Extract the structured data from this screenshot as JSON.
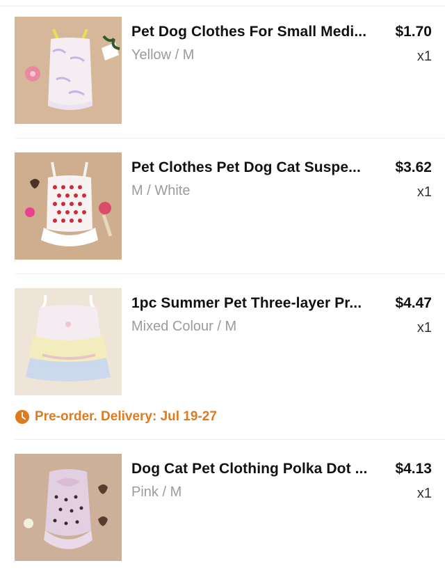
{
  "items": [
    {
      "title": "Pet Dog Clothes For Small Medi...",
      "variant": "Yellow / M",
      "price": "$1.70",
      "qty": "x1"
    },
    {
      "title": "Pet Clothes Pet Dog Cat Suspe...",
      "variant": "M / White",
      "price": "$3.62",
      "qty": "x1"
    },
    {
      "title": "1pc Summer Pet Three-layer Pr...",
      "variant": "Mixed Colour / M",
      "price": "$4.47",
      "qty": "x1"
    },
    {
      "title": "Dog Cat Pet Clothing Polka Dot ...",
      "variant": "Pink / M",
      "price": "$4.13",
      "qty": "x1"
    }
  ],
  "preorder": {
    "text": "Pre-order. Delivery: Jul 19-27",
    "icon": "clock-icon",
    "color": "#e07a1f"
  }
}
